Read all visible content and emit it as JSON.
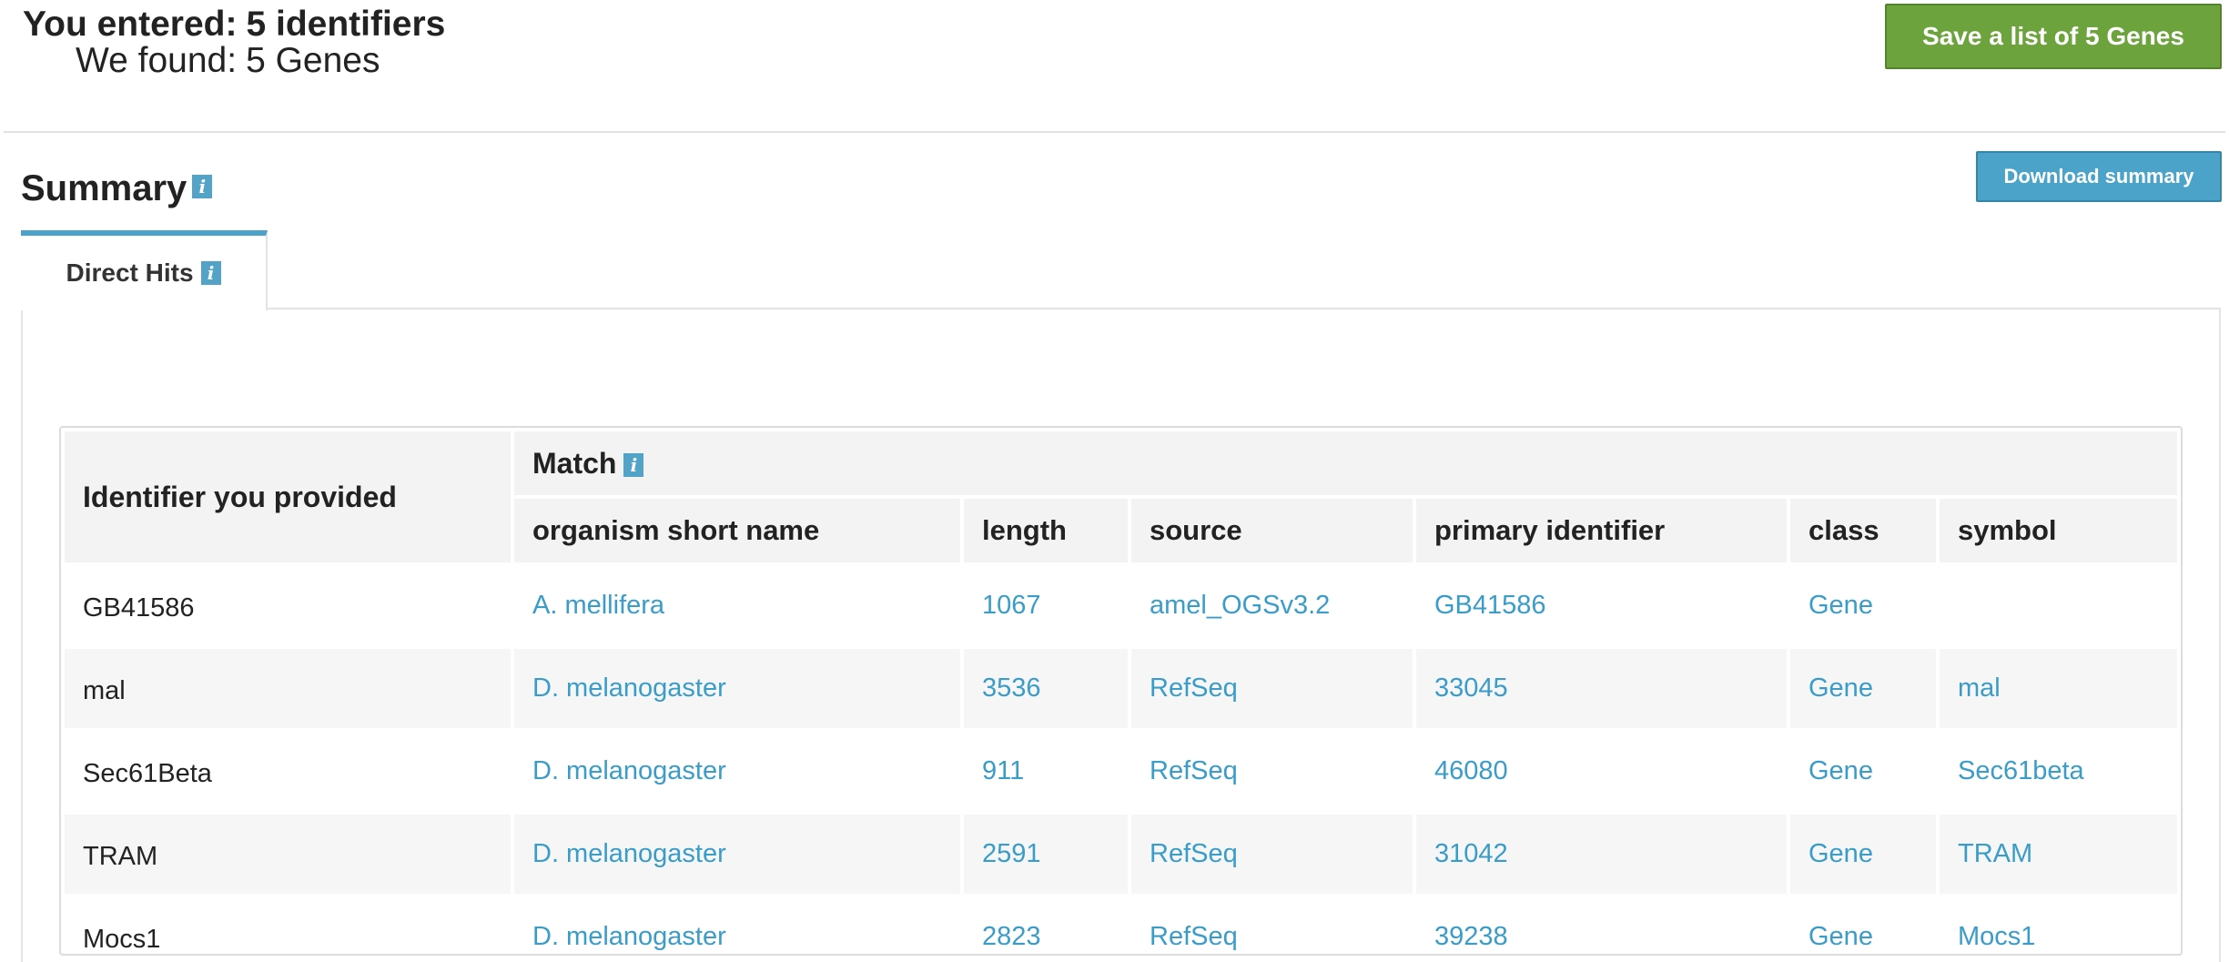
{
  "header": {
    "entered_label": "You entered:",
    "entered_value": "5 identifiers",
    "found_label": "We found:",
    "found_value": "5 Genes",
    "save_button": "Save a list of 5 Genes"
  },
  "summary": {
    "title": "Summary",
    "download_button": "Download summary"
  },
  "tabs": [
    {
      "label": "Direct Hits",
      "active": true
    }
  ],
  "table": {
    "identifier_header": "Identifier you provided",
    "match_header": "Match",
    "columns": [
      "organism short name",
      "length",
      "source",
      "primary identifier",
      "class",
      "symbol"
    ],
    "rows": [
      {
        "identifier": "GB41586",
        "organism": "A. mellifera",
        "length": "1067",
        "source": "amel_OGSv3.2",
        "primary": "GB41586",
        "class": "Gene",
        "symbol": ""
      },
      {
        "identifier": "mal",
        "organism": "D. melanogaster",
        "length": "3536",
        "source": "RefSeq",
        "primary": "33045",
        "class": "Gene",
        "symbol": "mal"
      },
      {
        "identifier": "Sec61Beta",
        "organism": "D. melanogaster",
        "length": "911",
        "source": "RefSeq",
        "primary": "46080",
        "class": "Gene",
        "symbol": "Sec61beta"
      },
      {
        "identifier": "TRAM",
        "organism": "D. melanogaster",
        "length": "2591",
        "source": "RefSeq",
        "primary": "31042",
        "class": "Gene",
        "symbol": "TRAM"
      },
      {
        "identifier": "Mocs1",
        "organism": "D. melanogaster",
        "length": "2823",
        "source": "RefSeq",
        "primary": "39238",
        "class": "Gene",
        "symbol": "Mocs1"
      }
    ]
  },
  "colors": {
    "save_button": "#6da33d",
    "download_button": "#4ba3c9",
    "link": "#3a9cc8",
    "info_icon": "#52a3c7"
  },
  "icons": {
    "info": "info-icon"
  }
}
